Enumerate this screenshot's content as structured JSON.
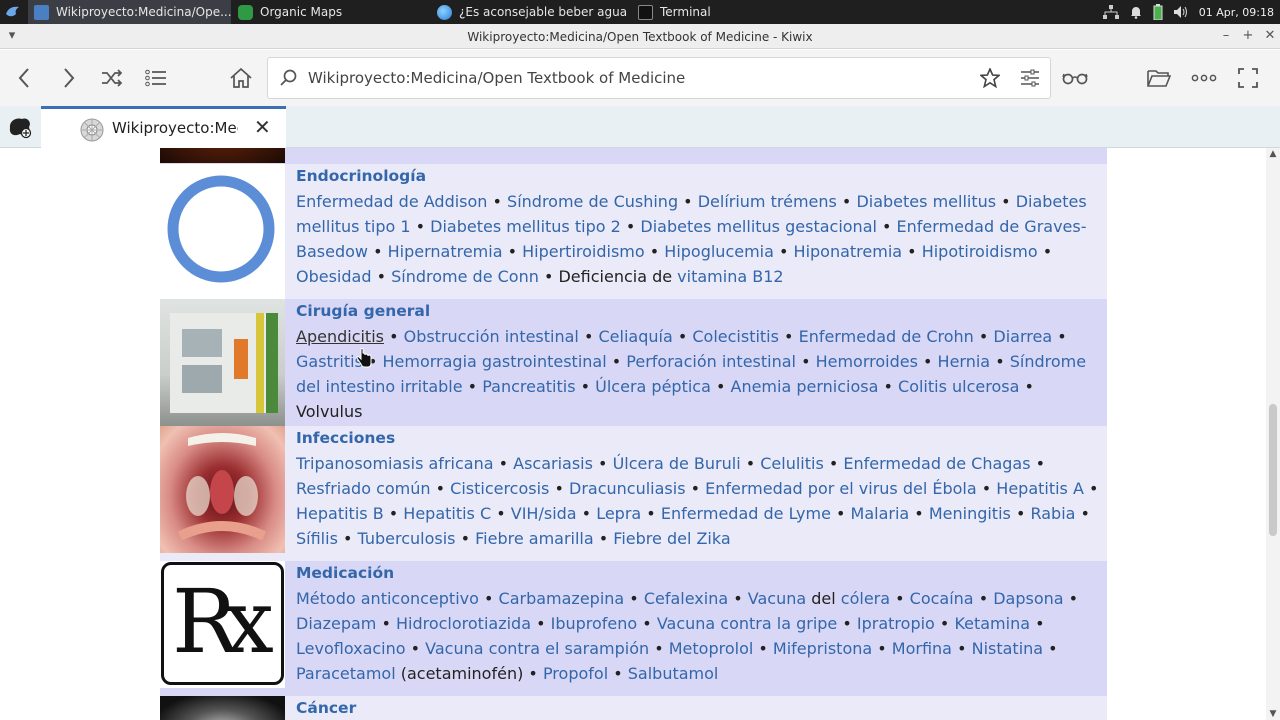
{
  "taskbar": {
    "tasks": [
      {
        "label": "Wikiproyecto:Medicina/Ope...",
        "active": true,
        "icon": "kiwix-icon"
      },
      {
        "label": "Organic Maps",
        "active": false,
        "icon": "organic-maps-icon"
      },
      {
        "label": "¿Es aconsejable beber agua ...",
        "active": false,
        "icon": "browser-globe-icon"
      },
      {
        "label": "Terminal",
        "active": false,
        "icon": "terminal-icon"
      }
    ],
    "clock": "01 Apr, 09:18"
  },
  "window": {
    "title": "Wikiproyecto:Medicina/Open Textbook of Medicine - Kiwix"
  },
  "toolbar": {
    "url": "Wikiproyecto:Medicina/Open Textbook of Medicine"
  },
  "tab": {
    "label": "Wikiproyecto:Medicina/Open Textbook of Medicine"
  },
  "colors": {
    "link": "#3366aa",
    "row_light": "#eaeaf8",
    "row_dark": "#d8d8f6",
    "tab_accent": "#3d6fb6"
  },
  "sections": [
    {
      "heading": "Endocrinología",
      "image": "blue-ring-icon",
      "items": [
        {
          "t": "Enfermedad de Addison",
          "l": true
        },
        {
          "t": "Síndrome de Cushing",
          "l": true
        },
        {
          "t": "Delírium trémens",
          "l": true
        },
        {
          "t": "Diabetes mellitus",
          "l": true
        },
        {
          "t": "Diabetes mellitus tipo 1",
          "l": true
        },
        {
          "t": "Diabetes mellitus tipo 2",
          "l": true
        },
        {
          "t": "Diabetes mellitus gestacional",
          "l": true
        },
        {
          "t": "Enfermedad de Graves-Basedow",
          "l": true
        },
        {
          "t": "Hipernatremia",
          "l": true
        },
        {
          "t": "Hipertiroidismo",
          "l": true
        },
        {
          "t": "Hipoglucemia",
          "l": true
        },
        {
          "t": "Hiponatremia",
          "l": true
        },
        {
          "t": "Hipotiroidismo",
          "l": true
        },
        {
          "t": "Obesidad",
          "l": true
        },
        {
          "t": "Síndrome de Conn",
          "l": true
        },
        {
          "parts": [
            {
              "t": "Deficiencia de ",
              "l": false
            },
            {
              "t": "vitamina B12",
              "l": true
            }
          ]
        }
      ]
    },
    {
      "heading": "Cirugía general",
      "image": "surgery-photo",
      "items": [
        {
          "t": "Apendicitis",
          "l": true,
          "hover": true
        },
        {
          "t": "Obstrucción intestinal",
          "l": true
        },
        {
          "t": "Celiaquía",
          "l": true
        },
        {
          "t": "Colecistitis",
          "l": true
        },
        {
          "t": "Enfermedad de Crohn",
          "l": true
        },
        {
          "t": "Diarrea",
          "l": true
        },
        {
          "t": "Gastritis",
          "l": true
        },
        {
          "t": "Hemorragia gastrointestinal",
          "l": true
        },
        {
          "t": "Perforación intestinal",
          "l": true
        },
        {
          "t": "Hemorroides",
          "l": true
        },
        {
          "t": "Hernia",
          "l": true
        },
        {
          "t": "Síndrome del intestino irritable",
          "l": true
        },
        {
          "t": "Pancreatitis",
          "l": true
        },
        {
          "t": "Úlcera péptica",
          "l": true
        },
        {
          "t": "Anemia perniciosa",
          "l": true
        },
        {
          "t": "Colitis ulcerosa",
          "l": true
        },
        {
          "t": "Volvulus",
          "l": false
        }
      ]
    },
    {
      "heading": "Infecciones",
      "image": "throat-photo",
      "items": [
        {
          "t": "Tripanosomiasis africana",
          "l": true
        },
        {
          "t": "Ascariasis",
          "l": true
        },
        {
          "t": "Úlcera de Buruli",
          "l": true
        },
        {
          "t": "Celulitis",
          "l": true
        },
        {
          "t": "Enfermedad de Chagas",
          "l": true
        },
        {
          "t": "Resfriado común",
          "l": true
        },
        {
          "t": "Cisticercosis",
          "l": true
        },
        {
          "t": "Dracunculiasis",
          "l": true
        },
        {
          "t": "Enfermedad por el virus del Ébola",
          "l": true
        },
        {
          "t": "Hepatitis A",
          "l": true
        },
        {
          "t": "Hepatitis B",
          "l": true
        },
        {
          "t": "Hepatitis C",
          "l": true
        },
        {
          "t": "VIH/sida",
          "l": true
        },
        {
          "t": "Lepra",
          "l": true
        },
        {
          "t": "Enfermedad de Lyme",
          "l": true
        },
        {
          "t": "Malaria",
          "l": true
        },
        {
          "t": "Meningitis",
          "l": true
        },
        {
          "t": "Rabia",
          "l": true
        },
        {
          "t": "Sífilis",
          "l": true
        },
        {
          "t": "Tuberculosis",
          "l": true
        },
        {
          "t": "Fiebre amarilla",
          "l": true
        },
        {
          "t": "Fiebre del Zika",
          "l": true
        }
      ]
    },
    {
      "heading": "Medicación",
      "image": "rx-symbol",
      "image_text": "Rx",
      "items": [
        {
          "t": "Método anticonceptivo",
          "l": true
        },
        {
          "t": "Carbamazepina",
          "l": true
        },
        {
          "t": "Cefalexina",
          "l": true
        },
        {
          "parts": [
            {
              "t": "Vacuna",
              "l": true
            },
            {
              "t": " del ",
              "l": false
            },
            {
              "t": "cólera",
              "l": true
            }
          ]
        },
        {
          "t": "Cocaína",
          "l": true
        },
        {
          "t": "Dapsona",
          "l": true
        },
        {
          "t": "Diazepam",
          "l": true
        },
        {
          "t": "Hidroclorotiazida",
          "l": true
        },
        {
          "t": "Ibuprofeno",
          "l": true
        },
        {
          "t": "Vacuna contra la gripe",
          "l": true
        },
        {
          "t": "Ipratropio",
          "l": true
        },
        {
          "t": "Ketamina",
          "l": true
        },
        {
          "t": "Levofloxacino",
          "l": true
        },
        {
          "t": "Vacuna contra el sarampión",
          "l": true
        },
        {
          "t": "Metoprolol",
          "l": true
        },
        {
          "t": "Mifepristona",
          "l": true
        },
        {
          "t": "Morfina",
          "l": true
        },
        {
          "t": "Nistatina",
          "l": true
        },
        {
          "parts": [
            {
              "t": "Paracetamol",
              "l": true
            },
            {
              "t": " (acetaminofén)",
              "l": false
            }
          ]
        },
        {
          "t": "Propofol",
          "l": true
        },
        {
          "t": "Salbutamol",
          "l": true
        }
      ]
    },
    {
      "heading": "Cáncer",
      "image": "ct-scan-photo",
      "items": []
    }
  ]
}
